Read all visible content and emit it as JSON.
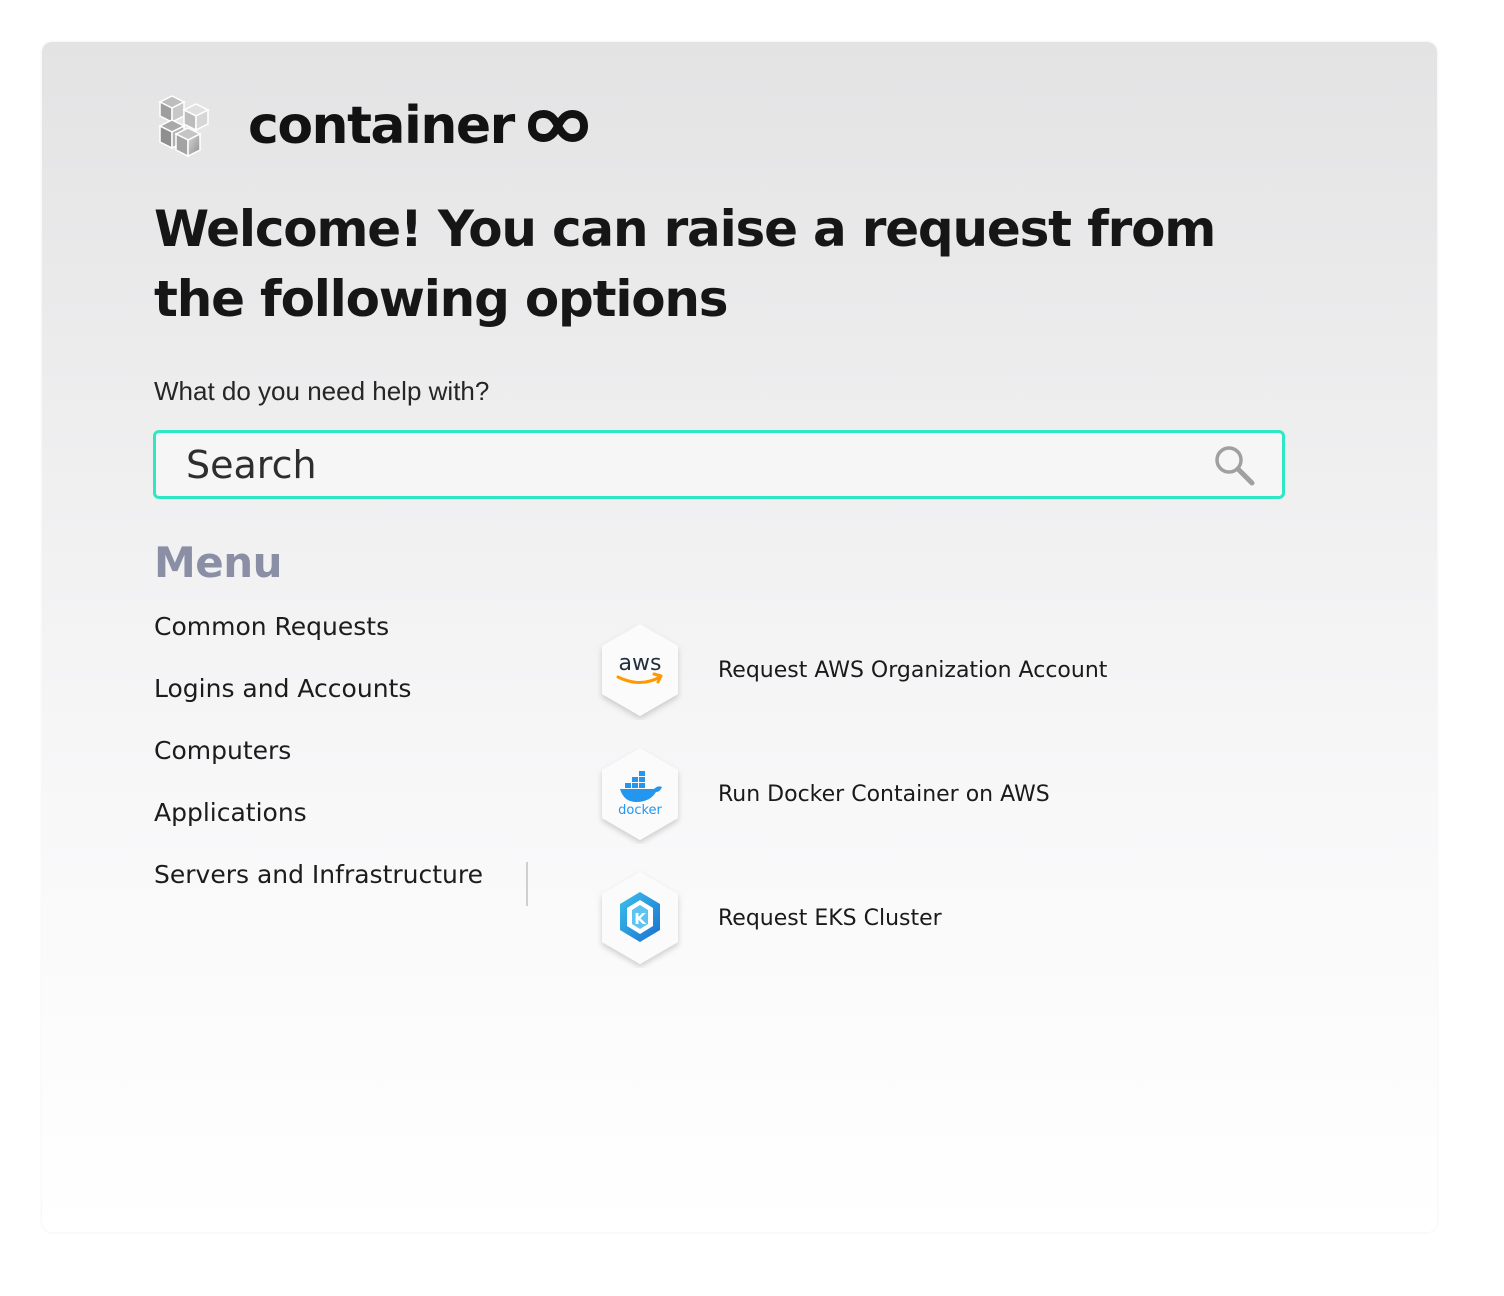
{
  "brand": {
    "name": "container",
    "logo_icon": "cubes-icon",
    "infinity_icon": "infinity-icon"
  },
  "headline": "Welcome! You can raise a request from the following options",
  "search": {
    "label": "What do you need help with?",
    "placeholder": "Search",
    "icon": "search-icon",
    "border_color": "#2ee8c4"
  },
  "menu": {
    "title": "Menu",
    "title_color": "#8a8fa6",
    "items": [
      {
        "label": "Common Requests"
      },
      {
        "label": "Logins and Accounts"
      },
      {
        "label": "Computers"
      },
      {
        "label": "Applications"
      },
      {
        "label": "Servers and Infrastructure"
      }
    ]
  },
  "options": [
    {
      "label": "Request AWS Organization Account",
      "icon": "aws-logo-icon",
      "icon_text": "aws"
    },
    {
      "label": "Run Docker Container on AWS",
      "icon": "docker-logo-icon",
      "icon_text": "docker"
    },
    {
      "label": "Request EKS Cluster",
      "icon": "eks-logo-icon",
      "icon_text": "K"
    }
  ]
}
